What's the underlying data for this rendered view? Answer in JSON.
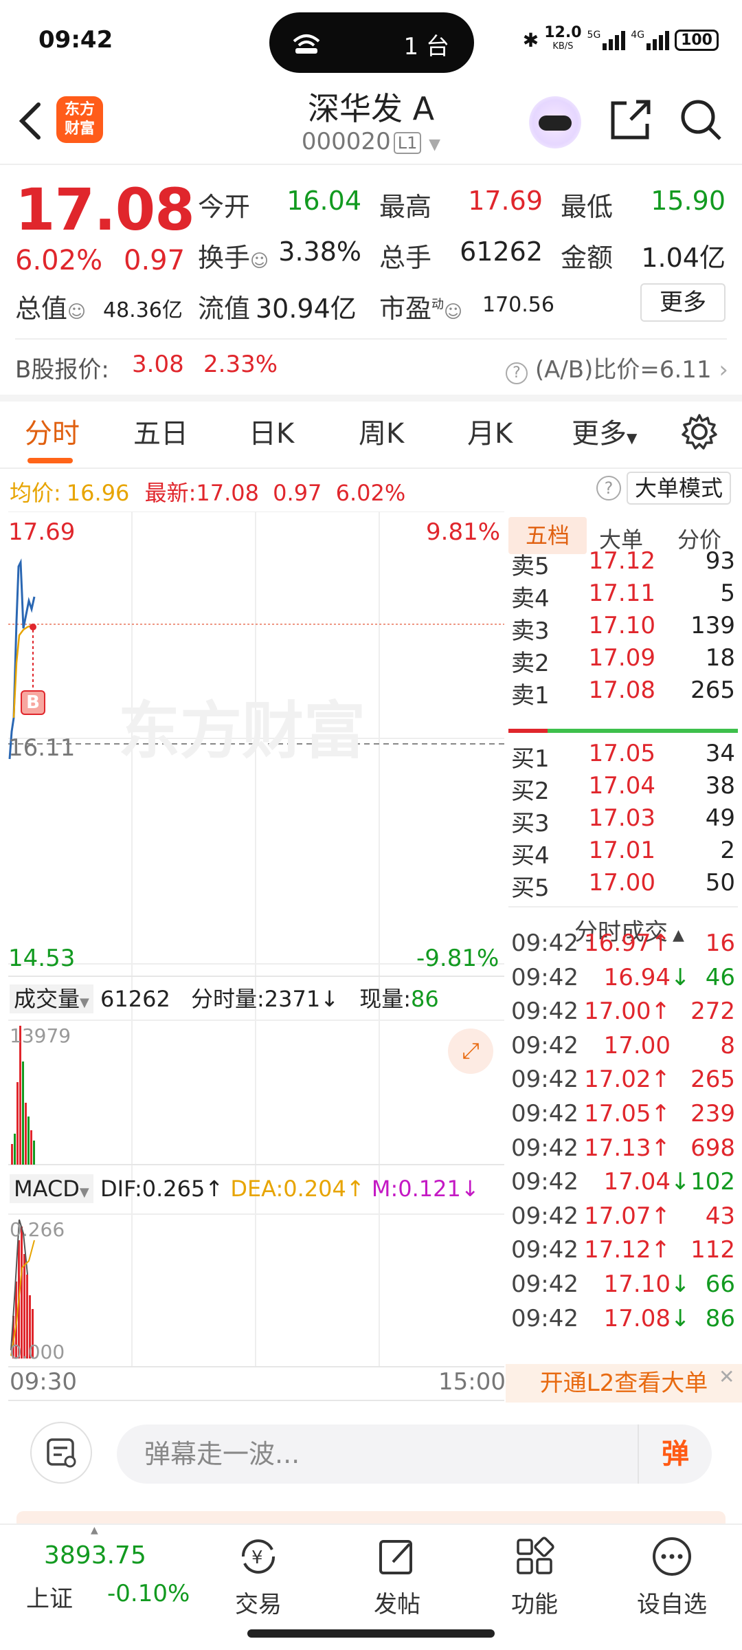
{
  "status_bar": {
    "time": "09:42",
    "island_count": "1 台",
    "speed_top": "12.0",
    "speed_unit": "KB/S",
    "net1": "5G",
    "net2": "4G",
    "battery": "100"
  },
  "header": {
    "logo_line1": "东方",
    "logo_line2": "财富",
    "name": "深华发 A",
    "code": "000020",
    "level": "L1"
  },
  "quote": {
    "price": "17.08",
    "pct": "6.02%",
    "change": "0.97",
    "open_label": "今开",
    "open": "16.04",
    "high_label": "最高",
    "high": "17.69",
    "low_label": "最低",
    "low": "15.90",
    "turnover_label": "换手",
    "turnover": "3.38%",
    "volume_label": "总手",
    "volume": "61262",
    "amount_label": "金额",
    "amount": "1.04亿",
    "mktcap_label": "总值",
    "mktcap": "48.36亿",
    "float_label": "流值",
    "float_cap": "30.94亿",
    "pe_label": "市盈",
    "pe_sup": "动",
    "pe": "170.56",
    "more": "更多",
    "b_label": "B股报价:",
    "b_price": "3.08",
    "b_pct": "2.33%",
    "ab_ratio": "(A/B)比价=6.11"
  },
  "tabs": [
    "分时",
    "五日",
    "日K",
    "周K",
    "月K",
    "更多"
  ],
  "chart": {
    "info_avg_label": "均价:",
    "avg": "16.96",
    "info_latest_label": "最新:",
    "latest": "17.08",
    "latest_chg": "0.97",
    "latest_pct": "6.02%",
    "big_mode": "大单模式",
    "y_top": "17.69",
    "y_top_pct": "9.81%",
    "y_mid": "16.11",
    "y_bottom": "14.53",
    "y_bottom_pct": "-9.81%",
    "watermark": "东方财富",
    "marker_b": "B",
    "vol_label": "成交量",
    "vol_total": "61262",
    "vol_min_label": "分时量:",
    "vol_min": "2371↓",
    "vol_now_label": "现量:",
    "vol_now": "86",
    "vol_axis": "13979",
    "macd_label": "MACD",
    "dif_label": "DIF:",
    "dif": "0.265↑",
    "dea_label": "DEA:",
    "dea": "0.204↑",
    "m_label": "M:",
    "m": "0.121↓",
    "macd_top": "0.266",
    "macd_bottom": "0.000",
    "t_start": "09:30",
    "t_end": "15:00"
  },
  "order_book": {
    "tabs": [
      "五档",
      "大单",
      "分价"
    ],
    "asks": [
      [
        "卖5",
        "17.12",
        "93"
      ],
      [
        "卖4",
        "17.11",
        "5"
      ],
      [
        "卖3",
        "17.10",
        "139"
      ],
      [
        "卖2",
        "17.09",
        "18"
      ],
      [
        "卖1",
        "17.08",
        "265"
      ]
    ],
    "bids": [
      [
        "买1",
        "17.05",
        "34"
      ],
      [
        "买2",
        "17.04",
        "38"
      ],
      [
        "买3",
        "17.03",
        "49"
      ],
      [
        "买4",
        "17.01",
        "2"
      ],
      [
        "买5",
        "17.00",
        "50"
      ]
    ],
    "ticks_title": "分时成交",
    "ticks": [
      [
        "09:42",
        "16.97↑",
        "16",
        "up"
      ],
      [
        "09:42",
        "16.94↓",
        "46",
        "down"
      ],
      [
        "09:42",
        "17.00↑",
        "272",
        "up"
      ],
      [
        "09:42",
        "17.00",
        "8",
        "up"
      ],
      [
        "09:42",
        "17.02↑",
        "265",
        "up"
      ],
      [
        "09:42",
        "17.05↑",
        "239",
        "up"
      ],
      [
        "09:42",
        "17.13↑",
        "698",
        "up"
      ],
      [
        "09:42",
        "17.04↓",
        "102",
        "down"
      ],
      [
        "09:42",
        "17.07↑",
        "43",
        "up"
      ],
      [
        "09:42",
        "17.12↑",
        "112",
        "up"
      ],
      [
        "09:42",
        "17.10↓",
        "66",
        "down"
      ],
      [
        "09:42",
        "17.08↓",
        "86",
        "down"
      ]
    ],
    "l2_promo": "开通L2查看大单"
  },
  "comment": {
    "placeholder": "弹幕走一波...",
    "dan": "弹"
  },
  "nav": {
    "index_value": "3893.75",
    "index_name": "上证",
    "index_pct": "-0.10%",
    "trade": "交易",
    "post": "发帖",
    "func": "功能",
    "watch": "设自选"
  }
}
